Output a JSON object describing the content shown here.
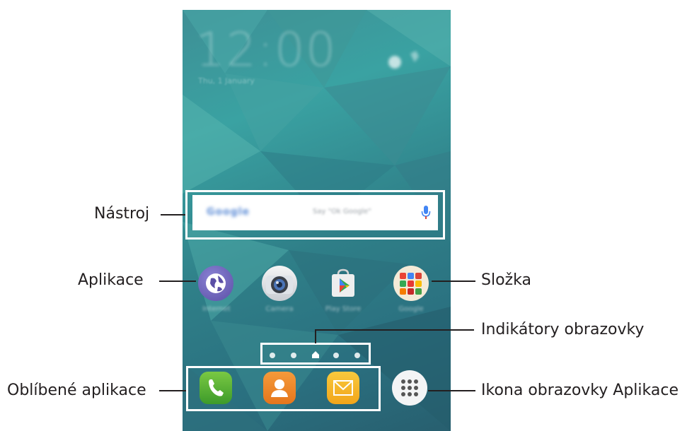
{
  "annotations": {
    "widget": "Nástroj",
    "app": "Aplikace",
    "folder": "Složka",
    "indicators": "Indikátory obrazovky",
    "favorites": "Oblíbené aplikace",
    "apps_icon": "Ikona obrazovky Aplikace"
  },
  "screen": {
    "clock": "12:00",
    "search_logo": "Google",
    "search_hint": "Say \"Ok Google\"",
    "apps": [
      {
        "name": "Internet",
        "icon": "globe-icon"
      },
      {
        "name": "Camera",
        "icon": "camera-icon"
      },
      {
        "name": "Play Store",
        "icon": "play-store-icon"
      },
      {
        "name": "Google",
        "icon": "folder-icon"
      }
    ],
    "dock": [
      {
        "name": "Phone",
        "icon": "phone-icon"
      },
      {
        "name": "Contacts",
        "icon": "contacts-icon"
      },
      {
        "name": "Messages",
        "icon": "envelope-icon"
      },
      {
        "name": "Apps",
        "icon": "apps-grid-icon"
      }
    ]
  },
  "colors": {
    "wallpaper": "#3a9a9c",
    "highlight": "#ffffff",
    "label_text": "#231f20"
  }
}
